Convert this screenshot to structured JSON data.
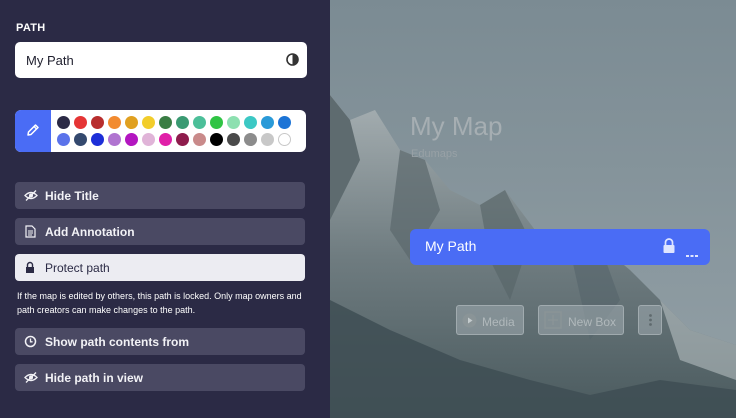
{
  "panel": {
    "section_label": "PATH",
    "path_name_value": "My Path",
    "contrast_icon": "contrast-icon",
    "pencil_icon": "pencil-icon",
    "colors_row1": [
      "#2b2a45",
      "#e53535",
      "#b82e2e",
      "#f28b30",
      "#e0a020",
      "#f2cd2b",
      "#3a7d44",
      "#3a9a72",
      "#4cbf99",
      "#30c444",
      "#8de0b0",
      "#3cc8c4",
      "#2a9ad8",
      "#1d74d6"
    ],
    "colors_row2": [
      "#5b73ea",
      "#34496e",
      "#1d2fd8",
      "#b074d0",
      "#b316c0",
      "#e0b4d8",
      "#e020a8",
      "#8e1c4c",
      "#c98a8a",
      "#000000",
      "#4a4a4a",
      "#8c8c8c",
      "#c8c8c8",
      "#ffffff"
    ],
    "options": {
      "hide_title": "Hide Title",
      "add_annotation": "Add Annotation",
      "protect_path": "Protect path",
      "show_contents": "Show path contents from",
      "hide_in_view": "Hide path in view"
    },
    "help_text": "If the map is edited by others, this path is locked. Only map owners and path creators can make changes to the path."
  },
  "map": {
    "title": "My Map",
    "subtitle": "Edumaps",
    "path_card": {
      "name": "My Path",
      "lock_icon": "lock-icon",
      "menu_icon": "more-icon"
    },
    "toolbar": {
      "media": "Media",
      "new_box": "New Box",
      "more_icon": "vertical-dots-icon"
    }
  },
  "colors": {
    "panel_bg": "#2b2a45",
    "accent": "#4a6cf5",
    "option_bg": "#4a4963"
  }
}
